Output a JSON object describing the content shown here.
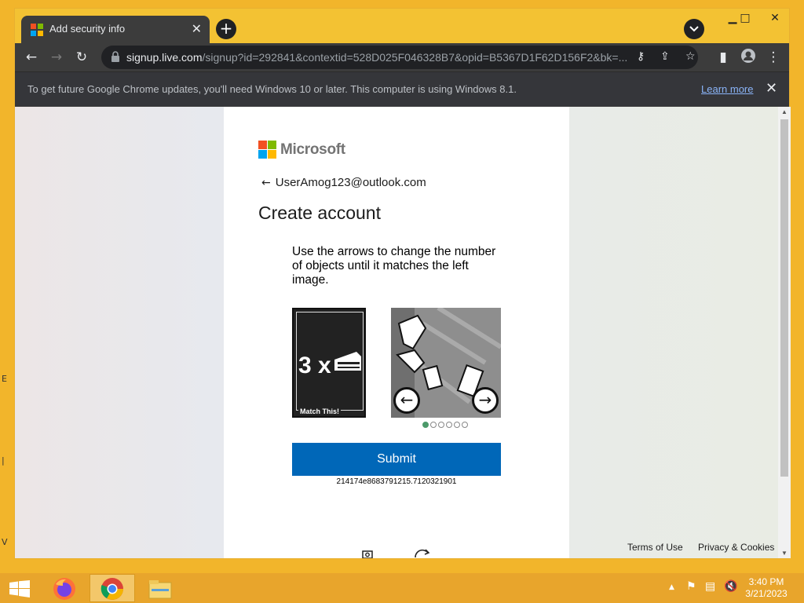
{
  "browser": {
    "tab_title": "Add security info",
    "tab_close": "✕",
    "new_tab": "+",
    "url_host": "signup.live.com",
    "url_path": "/signup?id=292841&contextid=528D025F046328B7&opid=B5367D1F62D156F2&bk=...",
    "infobar_message": "To get future Google Chrome updates, you'll need Windows 10 or later. This computer is using Windows 8.1.",
    "infobar_link": "Learn more",
    "infobar_close": "✕"
  },
  "page": {
    "brand": "Microsoft",
    "back_arrow": "←",
    "account_email": "UserAmog123@outlook.com",
    "title": "Create account",
    "instructions": "Use the arrows to change the number of objects until it matches the left image.",
    "reference_count": "3 x",
    "reference_caption": "Match This!",
    "left_arrow": "←",
    "right_arrow": "→",
    "dots_total": 6,
    "dots_active": 1,
    "submit_label": "Submit",
    "session_id": "214174e8683791215.7120321901",
    "footer_terms": "Terms of Use",
    "footer_privacy": "Privacy & Cookies"
  },
  "taskbar": {
    "time": "3:40 PM",
    "date": "3/21/2023"
  },
  "colors": {
    "ms_red": "#f25022",
    "ms_green": "#7fba00",
    "ms_blue": "#00a4ef",
    "ms_yellow": "#ffb900",
    "submit_blue": "#0067b8",
    "desktop_yellow": "#f3c233"
  }
}
